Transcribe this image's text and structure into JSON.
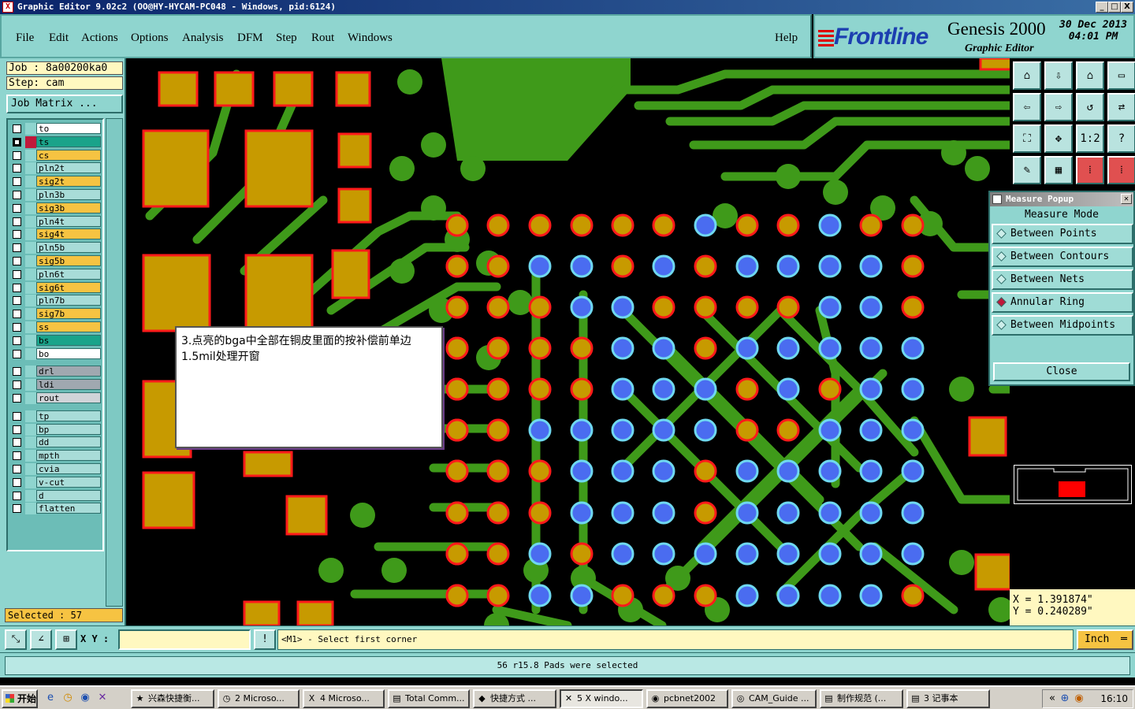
{
  "window": {
    "title": "Graphic Editor 9.02c2  (OO@HY-HYCAM-PC048 - Windows, pid:6124)",
    "min_label": "_",
    "max_label": "□",
    "close_label": "X"
  },
  "menu": {
    "file": "File",
    "edit": "Edit",
    "actions": "Actions",
    "options": "Options",
    "analysis": "Analysis",
    "dfm": "DFM",
    "step": "Step",
    "rout": "Rout",
    "windows": "Windows",
    "help": "Help"
  },
  "branding": {
    "frontline": "Frontline",
    "genesis": "Genesis 2000",
    "graphic_editor": "Graphic Editor",
    "date": "30 Dec 2013",
    "time": "04:01 PM"
  },
  "job": {
    "job_label": "Job : 8a00200ka0",
    "step_label": "Step: cam",
    "job_matrix": "Job Matrix ..."
  },
  "layers": [
    {
      "name": "to",
      "color": "#ffffff",
      "checked": false
    },
    {
      "name": "ts",
      "color": "#1aa38a",
      "checked": true
    },
    {
      "name": "cs",
      "color": "#f6c342",
      "checked": false
    },
    {
      "name": "pln2t",
      "color": "#a8dcd8",
      "checked": false
    },
    {
      "name": "sig2t",
      "color": "#f6c342",
      "checked": false
    },
    {
      "name": "pln3b",
      "color": "#a8dcd8",
      "checked": false
    },
    {
      "name": "sig3b",
      "color": "#f6c342",
      "checked": false
    },
    {
      "name": "pln4t",
      "color": "#a8dcd8",
      "checked": false
    },
    {
      "name": "sig4t",
      "color": "#f6c342",
      "checked": false
    },
    {
      "name": "pln5b",
      "color": "#a8dcd8",
      "checked": false
    },
    {
      "name": "sig5b",
      "color": "#f6c342",
      "checked": false
    },
    {
      "name": "pln6t",
      "color": "#a8dcd8",
      "checked": false
    },
    {
      "name": "sig6t",
      "color": "#f6c342",
      "checked": false
    },
    {
      "name": "pln7b",
      "color": "#a8dcd8",
      "checked": false
    },
    {
      "name": "sig7b",
      "color": "#f6c342",
      "checked": false
    },
    {
      "name": "ss",
      "color": "#f6c342",
      "checked": false
    },
    {
      "name": "bs",
      "color": "#1aa38a",
      "checked": false
    },
    {
      "name": "bo",
      "color": "#ffffff",
      "checked": false
    },
    {
      "name": "drl",
      "color": "#a0a8b0",
      "checked": false
    },
    {
      "name": "ldi",
      "color": "#a0a8b0",
      "checked": false
    },
    {
      "name": "rout",
      "color": "#d0d4d8",
      "checked": false
    },
    {
      "name": "tp",
      "color": "#a8dcd8",
      "checked": false
    },
    {
      "name": "bp",
      "color": "#a8dcd8",
      "checked": false
    },
    {
      "name": "dd",
      "color": "#a8dcd8",
      "checked": false
    },
    {
      "name": "mpth",
      "color": "#a8dcd8",
      "checked": false
    },
    {
      "name": "cvia",
      "color": "#a8dcd8",
      "checked": false
    },
    {
      "name": "v-cut",
      "color": "#a8dcd8",
      "checked": false
    },
    {
      "name": "d",
      "color": "#a8dcd8",
      "checked": false
    },
    {
      "name": "flatten",
      "color": "#a8dcd8",
      "checked": false
    }
  ],
  "selected": "Selected : 57",
  "note": "3.点亮的bga中全部在铜皮里面的按补偿前单边1.5mil处理开窗",
  "measure": {
    "title": "Measure Popup",
    "mode_label": "Measure Mode",
    "options": [
      "Between Points",
      "Between Contours",
      "Between Nets",
      "Annular Ring",
      "Between Midpoints"
    ],
    "active_option": "Annular Ring",
    "close": "Close"
  },
  "coords": {
    "x": "X = 1.391874\"",
    "y": "Y = 0.240289\""
  },
  "toolbar": {
    "ratio_label": "1:2",
    "help_label": "?"
  },
  "cmd": {
    "xy_label": "X Y :",
    "xy_value": "",
    "prompt": "<M1> - Select first corner",
    "unit": "Inch",
    "excl": "!"
  },
  "status_message": "56 r15.8 Pads were selected",
  "colors": {
    "copper": "#3f9a1a",
    "pad": "#c79a00",
    "selected_pad": "#4a6cf0",
    "pad_outline": "#ff1a1a",
    "panel": "#8fd5cf"
  },
  "taskbar": {
    "start": "开始",
    "tasks": [
      "兴森快捷衡...",
      "2 Microso...",
      "4 Microso...",
      "Total Comm...",
      "快捷方式 ...",
      "5 X windo...",
      "pcbnet2002",
      "CAM_Guide ...",
      "制作规范 (...",
      "3 记事本"
    ],
    "active_task": "5 X windo...",
    "clock": "16:10"
  }
}
